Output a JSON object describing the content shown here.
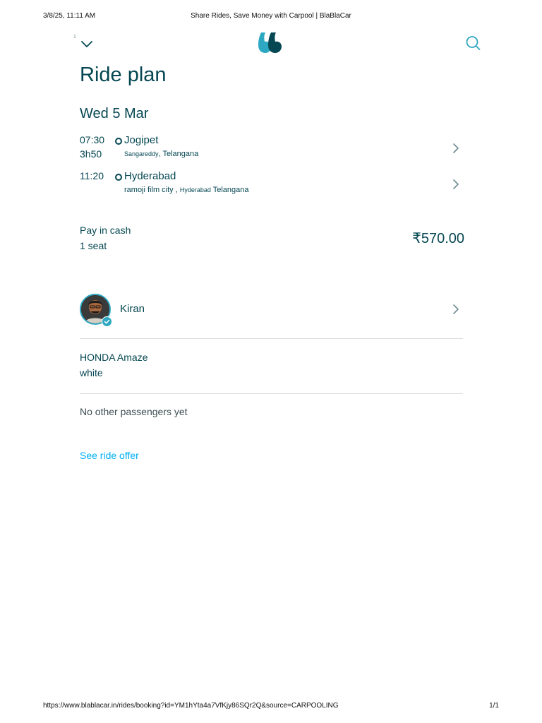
{
  "print_header": {
    "date": "3/8/25, 11:11 AM",
    "title": "Share Rides, Save Money with Carpool | BlaBlaCar"
  },
  "print_footer": {
    "url": "https://www.blablacar.in/rides/booking?id=YM1hYta4a7VfKjy86SQr2Q&source=CARPOOLING",
    "page": "1/1"
  },
  "topbar": {
    "marker": "1",
    "back_icon": "chevron-down-icon",
    "logo_icon": "blablacar-logo",
    "search_icon": "search-icon"
  },
  "page_title": "Ride plan",
  "ride": {
    "date": "Wed 5 Mar",
    "departure": {
      "time": "07:30",
      "duration": "3h50",
      "city": "Jogipet",
      "address_part1": "Sangareddy",
      "address_part2": ", Telangana"
    },
    "arrival": {
      "time": "11:20",
      "city": "Hyderabad",
      "address_part1": "ramoji film city ,",
      "address_part2": "Hyderabad",
      "address_part3": "Telangana"
    }
  },
  "payment": {
    "method": "Pay in cash",
    "seats": "1 seat",
    "price": "₹570.00"
  },
  "driver": {
    "name": "Kiran",
    "verified": true
  },
  "car": {
    "model": "HONDA Amaze",
    "color": "white"
  },
  "passengers_text": "No other passengers yet",
  "see_offer_link": "See ride offer",
  "colors": {
    "text": "#054752",
    "link": "#00aff5",
    "accent": "#2ea8c2",
    "divider": "#dddddd"
  }
}
